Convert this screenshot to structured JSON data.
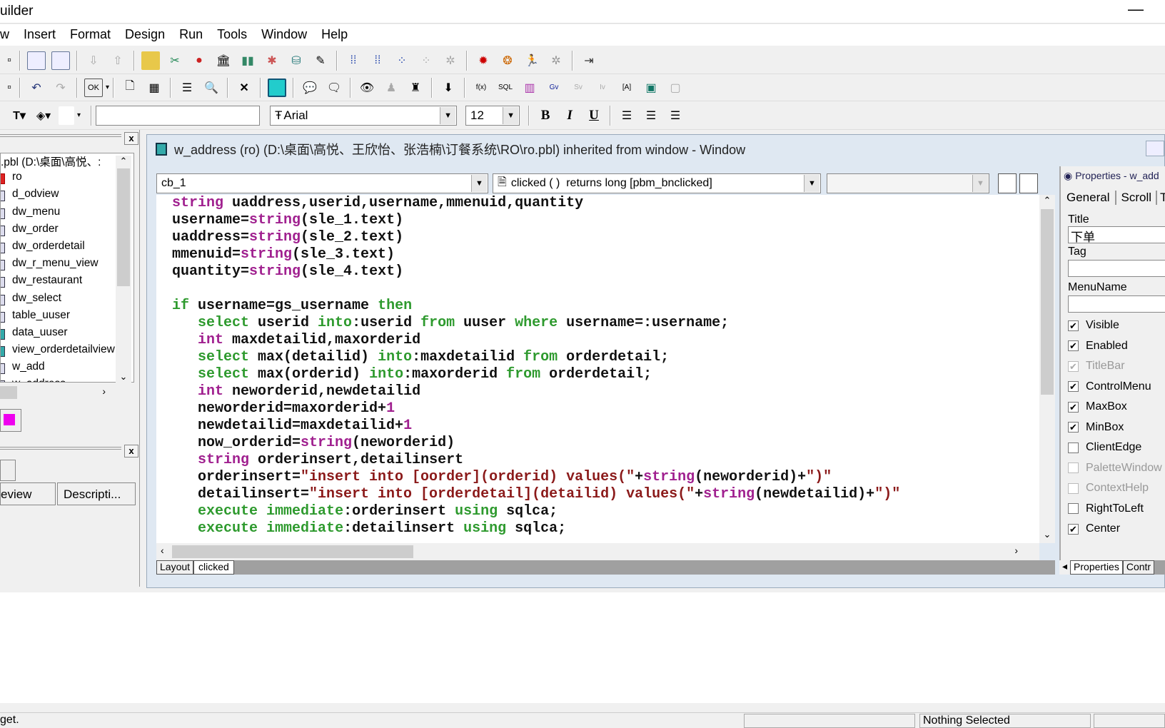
{
  "app": {
    "title_fragment": "uilder",
    "minimize": "—"
  },
  "menu": [
    "w",
    "Insert",
    "Format",
    "Design",
    "Run",
    "Tools",
    "Window",
    "Help"
  ],
  "toolbar3": {
    "style_input": "",
    "font": "Arial",
    "font_size": "12",
    "bold": "B",
    "italic": "I",
    "underline": "U"
  },
  "library": {
    "root": ".pbl (D:\\桌面\\高悦、:",
    "items": [
      {
        "name": "ro"
      },
      {
        "name": "d_odview"
      },
      {
        "name": "dw_menu"
      },
      {
        "name": "dw_order"
      },
      {
        "name": "dw_orderdetail"
      },
      {
        "name": "dw_r_menu_view"
      },
      {
        "name": "dw_restaurant"
      },
      {
        "name": "dw_select"
      },
      {
        "name": "table_uuser"
      },
      {
        "name": "data_uuser"
      },
      {
        "name": "view_orderdetailview"
      },
      {
        "name": "w_add"
      },
      {
        "name": "w_address"
      }
    ],
    "close": "x"
  },
  "lower_panel": {
    "tabs": [
      "eview",
      "Descripti..."
    ],
    "close": "x"
  },
  "editor": {
    "title": "w_address (ro) (D:\\桌面\\高悦、王欣怡、张浩楠\\订餐系统\\RO\\ro.pbl) inherited from window - Window",
    "object_select": "cb_1",
    "event_select": "clicked ( )  returns long [pbm_bnclicked]",
    "tabs": [
      "Layout",
      "clicked"
    ],
    "code": [
      [
        [
          "ty",
          "string"
        ],
        [
          "pl",
          " uaddress,userid,username,mmenuid,quantity"
        ]
      ],
      [
        [
          "pl",
          "username="
        ],
        [
          "ty",
          "string"
        ],
        [
          "pl",
          "(sle_1.text)"
        ]
      ],
      [
        [
          "pl",
          "uaddress="
        ],
        [
          "ty",
          "string"
        ],
        [
          "pl",
          "(sle_2.text)"
        ]
      ],
      [
        [
          "pl",
          "mmenuid="
        ],
        [
          "ty",
          "string"
        ],
        [
          "pl",
          "(sle_3.text)"
        ]
      ],
      [
        [
          "pl",
          "quantity="
        ],
        [
          "ty",
          "string"
        ],
        [
          "pl",
          "(sle_4.text)"
        ]
      ],
      [
        [
          "pl",
          ""
        ]
      ],
      [
        [
          "kw",
          "if"
        ],
        [
          "pl",
          " username=gs_username "
        ],
        [
          "kw",
          "then"
        ]
      ],
      [
        [
          "pl",
          "   "
        ],
        [
          "kw",
          "select"
        ],
        [
          "pl",
          " userid "
        ],
        [
          "kw",
          "into"
        ],
        [
          "pl",
          ":userid "
        ],
        [
          "kw",
          "from"
        ],
        [
          "pl",
          " uuser "
        ],
        [
          "kw",
          "where"
        ],
        [
          "pl",
          " username=:username;"
        ]
      ],
      [
        [
          "pl",
          "   "
        ],
        [
          "ty",
          "int"
        ],
        [
          "pl",
          " maxdetailid,maxorderid"
        ]
      ],
      [
        [
          "pl",
          "   "
        ],
        [
          "kw",
          "select"
        ],
        [
          "pl",
          " max(detailid) "
        ],
        [
          "kw",
          "into"
        ],
        [
          "pl",
          ":maxdetailid "
        ],
        [
          "kw",
          "from"
        ],
        [
          "pl",
          " orderdetail;"
        ]
      ],
      [
        [
          "pl",
          "   "
        ],
        [
          "kw",
          "select"
        ],
        [
          "pl",
          " max(orderid) "
        ],
        [
          "kw",
          "into"
        ],
        [
          "pl",
          ":maxorderid "
        ],
        [
          "kw",
          "from"
        ],
        [
          "pl",
          " orderdetail;"
        ]
      ],
      [
        [
          "pl",
          "   "
        ],
        [
          "ty",
          "int"
        ],
        [
          "pl",
          " neworderid,newdetailid"
        ]
      ],
      [
        [
          "pl",
          "   neworderid=maxorderid+"
        ],
        [
          "ty",
          "1"
        ]
      ],
      [
        [
          "pl",
          "   newdetailid=maxdetailid+"
        ],
        [
          "ty",
          "1"
        ]
      ],
      [
        [
          "pl",
          "   now_orderid="
        ],
        [
          "ty",
          "string"
        ],
        [
          "pl",
          "(neworderid)"
        ]
      ],
      [
        [
          "pl",
          "   "
        ],
        [
          "ty",
          "string"
        ],
        [
          "pl",
          " orderinsert,detailinsert"
        ]
      ],
      [
        [
          "pl",
          "   orderinsert="
        ],
        [
          "st",
          "\"insert into [oorder](orderid) values(\""
        ],
        [
          "pl",
          "+"
        ],
        [
          "ty",
          "string"
        ],
        [
          "pl",
          "(neworderid)+"
        ],
        [
          "st",
          "\")\""
        ]
      ],
      [
        [
          "pl",
          "   detailinsert="
        ],
        [
          "st",
          "\"insert into [orderdetail](detailid) values(\""
        ],
        [
          "pl",
          "+"
        ],
        [
          "ty",
          "string"
        ],
        [
          "pl",
          "(newdetailid)+"
        ],
        [
          "st",
          "\")\""
        ]
      ],
      [
        [
          "pl",
          "   "
        ],
        [
          "kw",
          "execute"
        ],
        [
          "pl",
          " "
        ],
        [
          "kw",
          "immediate"
        ],
        [
          "pl",
          ":orderinsert "
        ],
        [
          "kw",
          "using"
        ],
        [
          "pl",
          " sqlca;"
        ]
      ],
      [
        [
          "pl",
          "   "
        ],
        [
          "kw",
          "execute"
        ],
        [
          "pl",
          " "
        ],
        [
          "kw",
          "immediate"
        ],
        [
          "pl",
          ":detailinsert "
        ],
        [
          "kw",
          "using"
        ],
        [
          "pl",
          " sqlca;"
        ]
      ]
    ]
  },
  "properties": {
    "header": "Properties - w_add",
    "tabs": [
      "General",
      "Scroll",
      "T"
    ],
    "title_label": "Title",
    "title_value": "下单",
    "tag_label": "Tag",
    "tag_value": "",
    "menuname_label": "MenuName",
    "menuname_value": "",
    "checkboxes": [
      {
        "label": "Visible",
        "checked": true,
        "enabled": true
      },
      {
        "label": "Enabled",
        "checked": true,
        "enabled": true
      },
      {
        "label": "TitleBar",
        "checked": true,
        "enabled": false
      },
      {
        "label": "ControlMenu",
        "checked": true,
        "enabled": true
      },
      {
        "label": "MaxBox",
        "checked": true,
        "enabled": true
      },
      {
        "label": "MinBox",
        "checked": true,
        "enabled": true
      },
      {
        "label": "ClientEdge",
        "checked": false,
        "enabled": true
      },
      {
        "label": "PaletteWindow",
        "checked": false,
        "enabled": false
      },
      {
        "label": "ContextHelp",
        "checked": false,
        "enabled": false
      },
      {
        "label": "RightToLeft",
        "checked": false,
        "enabled": true
      },
      {
        "label": "Center",
        "checked": true,
        "enabled": true
      }
    ],
    "bottom_tabs": [
      "Properties",
      "Contr"
    ]
  },
  "status": {
    "left": "get.",
    "middle": "Nothing Selected"
  }
}
